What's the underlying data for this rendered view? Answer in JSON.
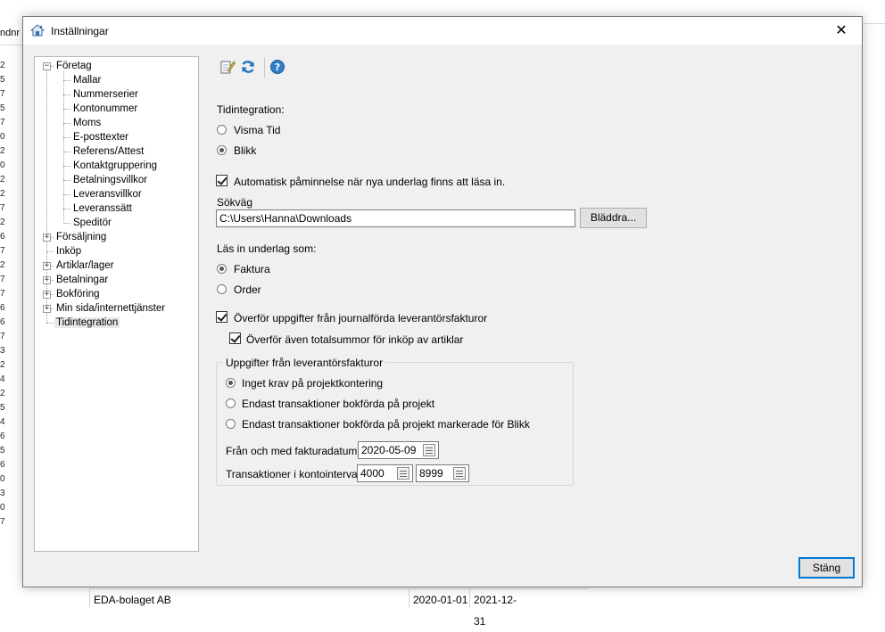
{
  "background": {
    "header_cut": "ndnr",
    "row_numbers": [
      "2",
      "5",
      "7",
      "5",
      "7",
      "0",
      "2",
      "0",
      "2",
      "2",
      "7",
      "2",
      "6",
      "7",
      "2",
      "7",
      "7",
      "6",
      "6",
      "7",
      "3",
      "2",
      "4",
      "2",
      "5",
      "4",
      "6",
      "5",
      "6",
      "0",
      "3",
      "0",
      "7"
    ],
    "bottom_row": {
      "name": "EDA-bolaget AB",
      "from": "2020-01-01",
      "to": "2021-12-31"
    }
  },
  "dialog": {
    "title": "Inställningar",
    "close_glyph": "✕"
  },
  "tree": {
    "items": [
      {
        "label": "Företag",
        "expander": "−"
      },
      {
        "label": "Mallar"
      },
      {
        "label": "Nummerserier"
      },
      {
        "label": "Kontonummer"
      },
      {
        "label": "Moms"
      },
      {
        "label": "E-posttexter"
      },
      {
        "label": "Referens/Attest"
      },
      {
        "label": "Kontaktgruppering"
      },
      {
        "label": "Betalningsvillkor"
      },
      {
        "label": "Leveransvillkor"
      },
      {
        "label": "Leveranssätt"
      },
      {
        "label": "Speditör"
      },
      {
        "label": "Försäljning",
        "expander": "+"
      },
      {
        "label": "Inköp"
      },
      {
        "label": "Artiklar/lager",
        "expander": "+"
      },
      {
        "label": "Betalningar",
        "expander": "+"
      },
      {
        "label": "Bokföring",
        "expander": "+"
      },
      {
        "label": "Min sida/internettjänster",
        "expander": "+"
      },
      {
        "label": "Tidintegration",
        "selected": true
      }
    ]
  },
  "toolbar": {
    "icons": [
      "edit-icon",
      "refresh-icon",
      "help-icon"
    ]
  },
  "form": {
    "tidintegration_label": "Tidintegration:",
    "radio_visma_tid": "Visma Tid",
    "radio_blikk": "Blikk",
    "auto_reminder_label": "Automatisk påminnelse när nya underlag finns att läsa in.",
    "sokvag_label": "Sökväg",
    "sokvag_value": "C:\\Users\\Hanna\\Downloads",
    "browse_button": "Bläddra...",
    "las_in_label": "Läs in underlag som:",
    "radio_faktura": "Faktura",
    "radio_order": "Order",
    "transfer_label": "Överför uppgifter från journalförda leverantörsfakturor",
    "transfer_totals_label": "Överför även totalsummor för inköp av artiklar",
    "group_title": "Uppgifter från leverantörsfakturor",
    "radio_no_req": "Inget krav på projektkontering",
    "radio_only_proj": "Endast transaktioner bokförda på projekt",
    "radio_only_proj_blikk": "Endast transaktioner bokförda på projekt markerade för Blikk",
    "date_label": "Från och med fakturadatum:",
    "date_value": "2020-05-09",
    "account_label": "Transaktioner i kontointervall:",
    "account_from": "4000",
    "account_to": "8999"
  },
  "footer": {
    "close_button": "Stäng"
  },
  "colors": {
    "dialog_bg": "#f0f0f0",
    "accent": "#0078d7",
    "refresh_blue": "#1e73be",
    "help_blue": "#2f7ec7"
  }
}
